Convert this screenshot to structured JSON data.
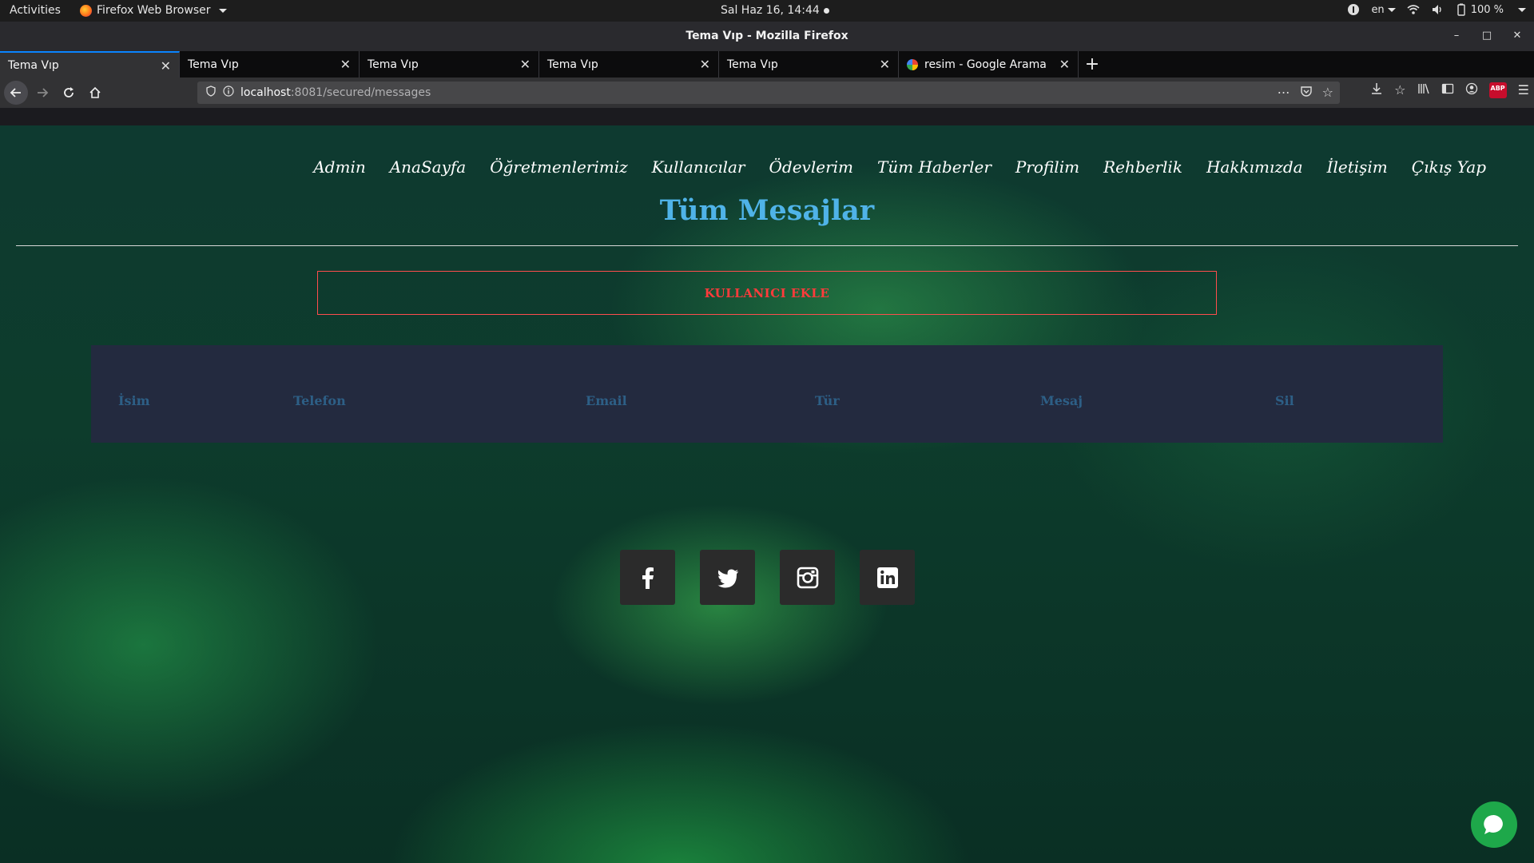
{
  "system_bar": {
    "activities": "Activities",
    "app_name": "Firefox Web Browser",
    "clock": "Sal Haz 16, 14:44",
    "language": "en",
    "battery": "100 %"
  },
  "window": {
    "title": "Tema Vıp - Mozilla Firefox"
  },
  "tabs": [
    {
      "label": "Tema Vıp"
    },
    {
      "label": "Tema Vıp"
    },
    {
      "label": "Tema Vıp"
    },
    {
      "label": "Tema Vıp"
    },
    {
      "label": "Tema Vıp"
    },
    {
      "label": "resim - Google Arama"
    }
  ],
  "address_bar": {
    "host": "localhost",
    "rest": ":8081/secured/messages"
  },
  "site": {
    "nav": [
      "Admin",
      "AnaSayfa",
      "Öğretmenlerimiz",
      "Kullanıcılar",
      "Ödevlerim",
      "Tüm Haberler",
      "Profilim",
      "Rehberlik",
      "Hakkımızda",
      "İletişim",
      "Çıkış Yap"
    ],
    "page_title": "Tüm Mesajlar",
    "add_button": "KULLANICI EKLE",
    "table_headers": [
      "İsim",
      "Telefon",
      "Email",
      "Tür",
      "Mesaj",
      "Sil"
    ],
    "social_icons": [
      "facebook-icon",
      "twitter-icon",
      "instagram-icon",
      "linkedin-icon"
    ]
  },
  "colors": {
    "title": "#4fb3e8",
    "add_button": "#ff3b3b",
    "table_bg": "#232a3f",
    "table_header_text": "#2d5f86",
    "chat_bubble": "#1ea84a",
    "tab_accent": "#0a84ff"
  }
}
